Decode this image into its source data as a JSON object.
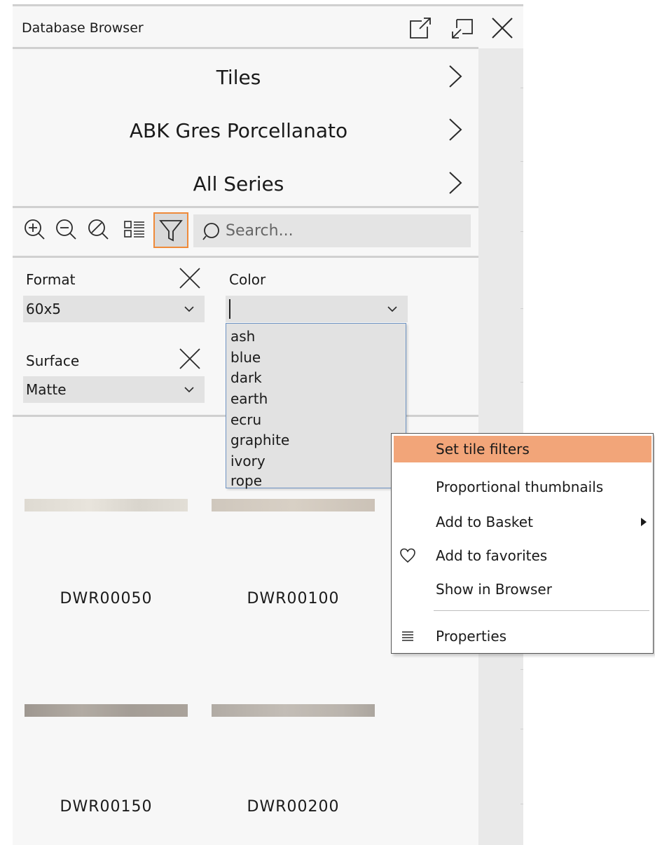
{
  "window": {
    "title": "Database Browser"
  },
  "breadcrumbs": [
    {
      "label": "Tiles"
    },
    {
      "label": "ABK Gres Porcellanato"
    },
    {
      "label": "All Series"
    }
  ],
  "toolbar": {
    "tools": [
      "zoom-in-icon",
      "zoom-out-icon",
      "zoom-reset-icon",
      "view-mode-icon",
      "filter-icon"
    ],
    "search_placeholder": "Search..."
  },
  "filters": {
    "format": {
      "label": "Format",
      "value": "60x5"
    },
    "surface": {
      "label": "Surface",
      "value": "Matte"
    },
    "color": {
      "label": "Color",
      "value": "",
      "options": [
        "ash",
        "blue",
        "dark",
        "earth",
        "ecru",
        "graphite",
        "ivory",
        "rope"
      ]
    }
  },
  "tiles": [
    {
      "name": "DWR00050"
    },
    {
      "name": "DWR00100"
    },
    {
      "name": "DWR00150"
    },
    {
      "name": "DWR00200"
    }
  ],
  "context_menu": {
    "items": [
      {
        "label": "Set tile filters",
        "highlighted": true
      },
      {
        "label": "Proportional thumbnails"
      },
      {
        "label": "Add to Basket",
        "submenu": true
      },
      {
        "label": "Add to favorites",
        "icon": "heart-icon"
      },
      {
        "label": "Show in Browser"
      },
      {
        "label": "Properties",
        "icon": "properties-icon"
      }
    ]
  },
  "colors": {
    "accent": "#ef8a3a",
    "menu_highlight": "#f2a579",
    "dropdown_border": "#6d93c3"
  }
}
